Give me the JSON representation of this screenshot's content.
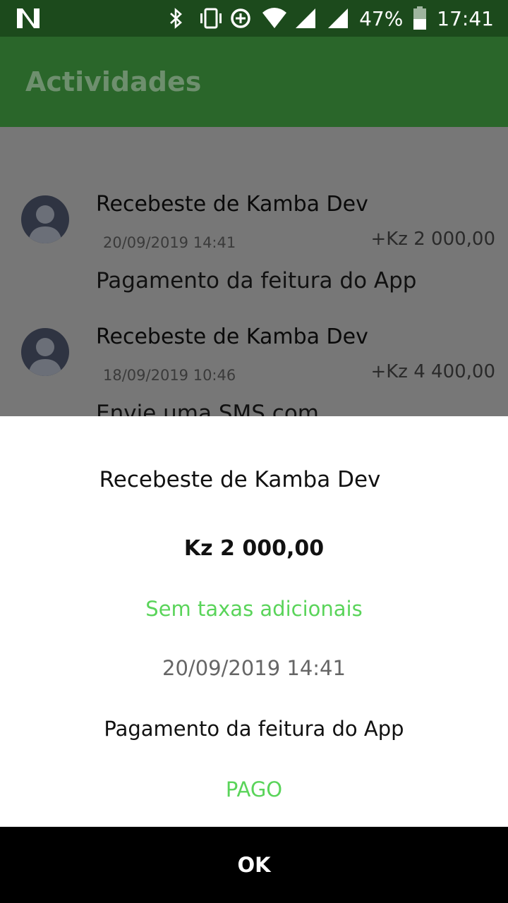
{
  "status_bar": {
    "battery_percent": "47%",
    "time": "17:41",
    "icons": [
      "notification-n-icon",
      "bluetooth-icon",
      "vibrate-icon",
      "data-saver-icon",
      "wifi-icon",
      "signal-icon",
      "signal-icon",
      "battery-icon"
    ]
  },
  "app_bar": {
    "title": "Actividades"
  },
  "activities": [
    {
      "title": "Recebeste de Kamba Dev",
      "date": "20/09/2019 14:41",
      "amount": "+Kz 2 000,00",
      "description": "Pagamento da feitura do App"
    },
    {
      "title": "Recebeste de Kamba Dev",
      "date": "18/09/2019 10:46",
      "amount": "+Kz 4 400,00",
      "description": "Envie uma SMS com"
    }
  ],
  "detail": {
    "title": "Recebeste de Kamba Dev",
    "amount": "Kz 2 000,00",
    "fees": "Sem taxas adicionais",
    "date": "20/09/2019 14:41",
    "description": "Pagamento da feitura do App",
    "status": "PAGO"
  },
  "ok_button": {
    "label": "OK"
  },
  "colors": {
    "status_bar": "#1c4a1c",
    "app_bar": "#2a662a",
    "accent_green": "#5ad45a"
  }
}
